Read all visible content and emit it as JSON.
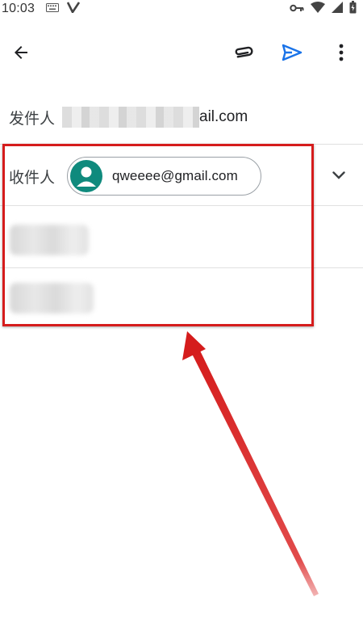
{
  "status_bar": {
    "time": "10:03",
    "left_icons": [
      "keyboard-icon",
      "v-app-icon"
    ],
    "right_icons": [
      "vpn-key-icon",
      "wifi-icon",
      "signal-icon",
      "battery-icon"
    ]
  },
  "toolbar": {
    "back_icon": "arrow-back-icon",
    "attach_icon": "paperclip-icon",
    "send_icon": "send-icon",
    "more_icon": "more-vert-icon"
  },
  "from": {
    "label": "发件人",
    "value_visible": "ail.com"
  },
  "to": {
    "label": "收件人",
    "chip_email": "qweeee@gmail.com",
    "expand_icon": "chevron-down-icon"
  },
  "colors": {
    "accent": "#1a73e8",
    "avatar": "#0f8a7d",
    "highlight": "#d51c1c"
  }
}
